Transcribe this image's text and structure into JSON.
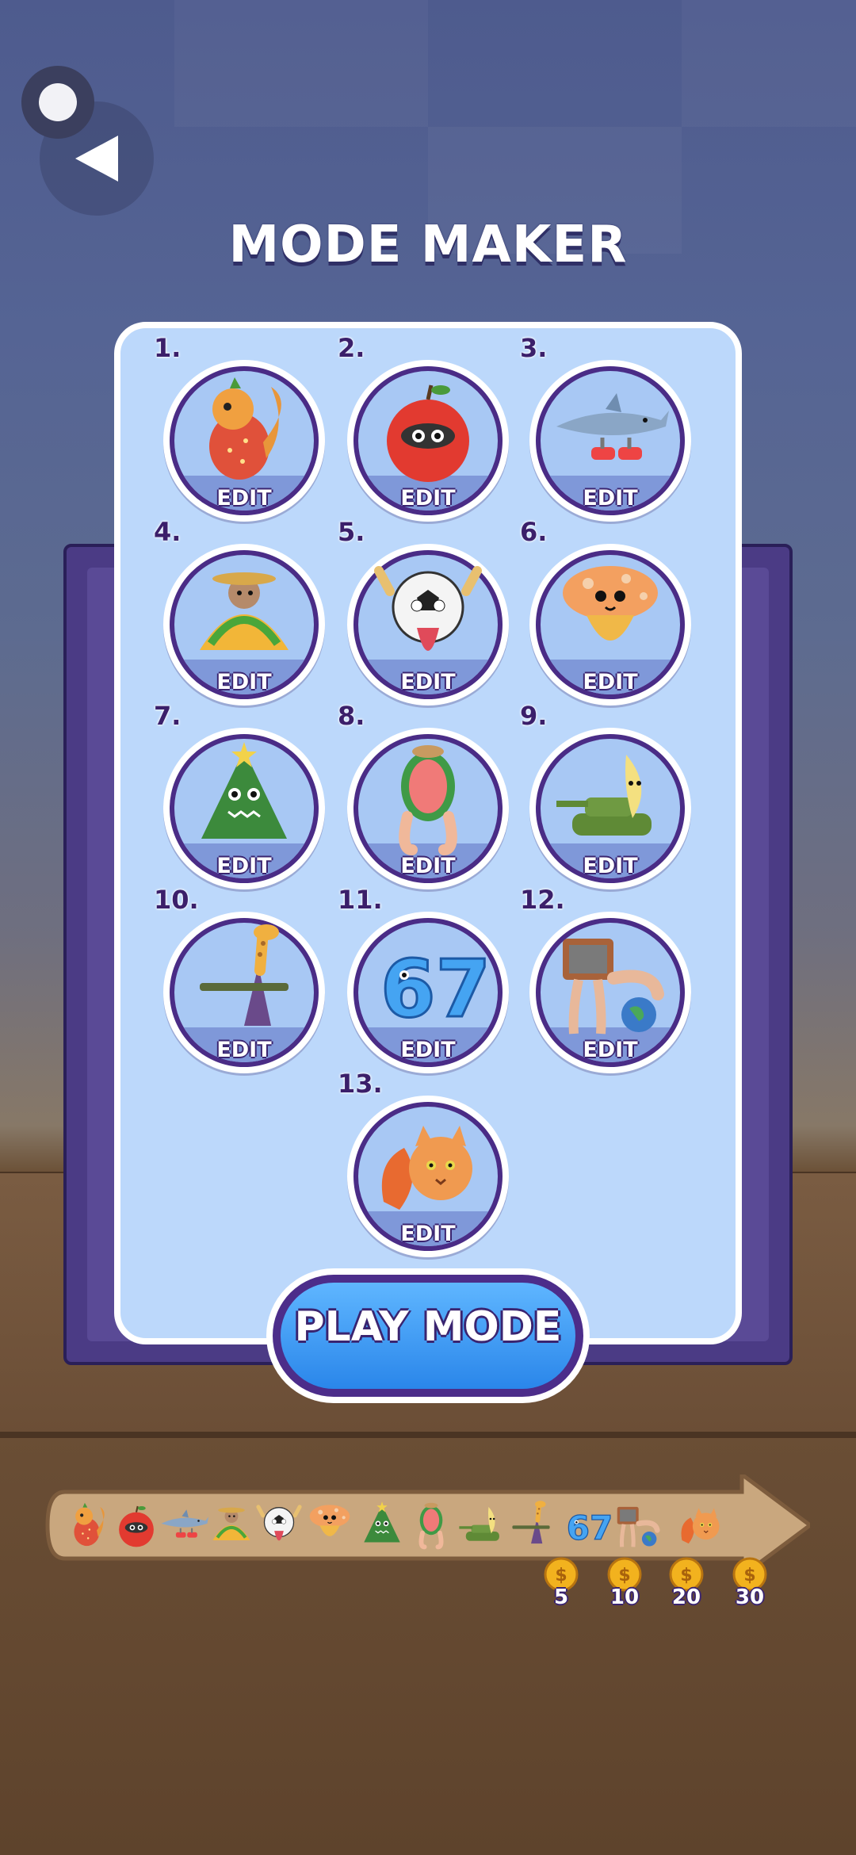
{
  "header": {
    "title": "MODE MAKER",
    "back_icon": "back-arrow-icon"
  },
  "slots": [
    {
      "num": "1.",
      "action": "EDIT",
      "character": "strawberry-squirrel"
    },
    {
      "num": "2.",
      "action": "EDIT",
      "character": "apple-raccoon"
    },
    {
      "num": "3.",
      "action": "EDIT",
      "character": "shark-with-sneakers"
    },
    {
      "num": "4.",
      "action": "EDIT",
      "character": "taco-mouse"
    },
    {
      "num": "5.",
      "action": "EDIT",
      "character": "soccer-ball-face"
    },
    {
      "num": "6.",
      "action": "EDIT",
      "character": "mushroom-creature"
    },
    {
      "num": "7.",
      "action": "EDIT",
      "character": "christmas-tree-monster"
    },
    {
      "num": "8.",
      "action": "EDIT",
      "character": "watermelon-legs"
    },
    {
      "num": "9.",
      "action": "EDIT",
      "character": "banana-tank"
    },
    {
      "num": "10.",
      "action": "EDIT",
      "character": "giraffe-eiffel-plane"
    },
    {
      "num": "11.",
      "action": "EDIT",
      "character": "number-67"
    },
    {
      "num": "12.",
      "action": "EDIT",
      "character": "tv-legs-earth"
    },
    {
      "num": "13.",
      "action": "EDIT",
      "character": "cat-shrimp"
    }
  ],
  "play_button": {
    "label": "PLAY MODE"
  },
  "progress": {
    "coin_icon": "coin-icon",
    "rewards": [
      "5",
      "10",
      "20",
      "30"
    ]
  },
  "colors": {
    "panel": "#bcd8fb",
    "accent_purple": "#4a2c86",
    "play_blue": "#2a86ea"
  }
}
